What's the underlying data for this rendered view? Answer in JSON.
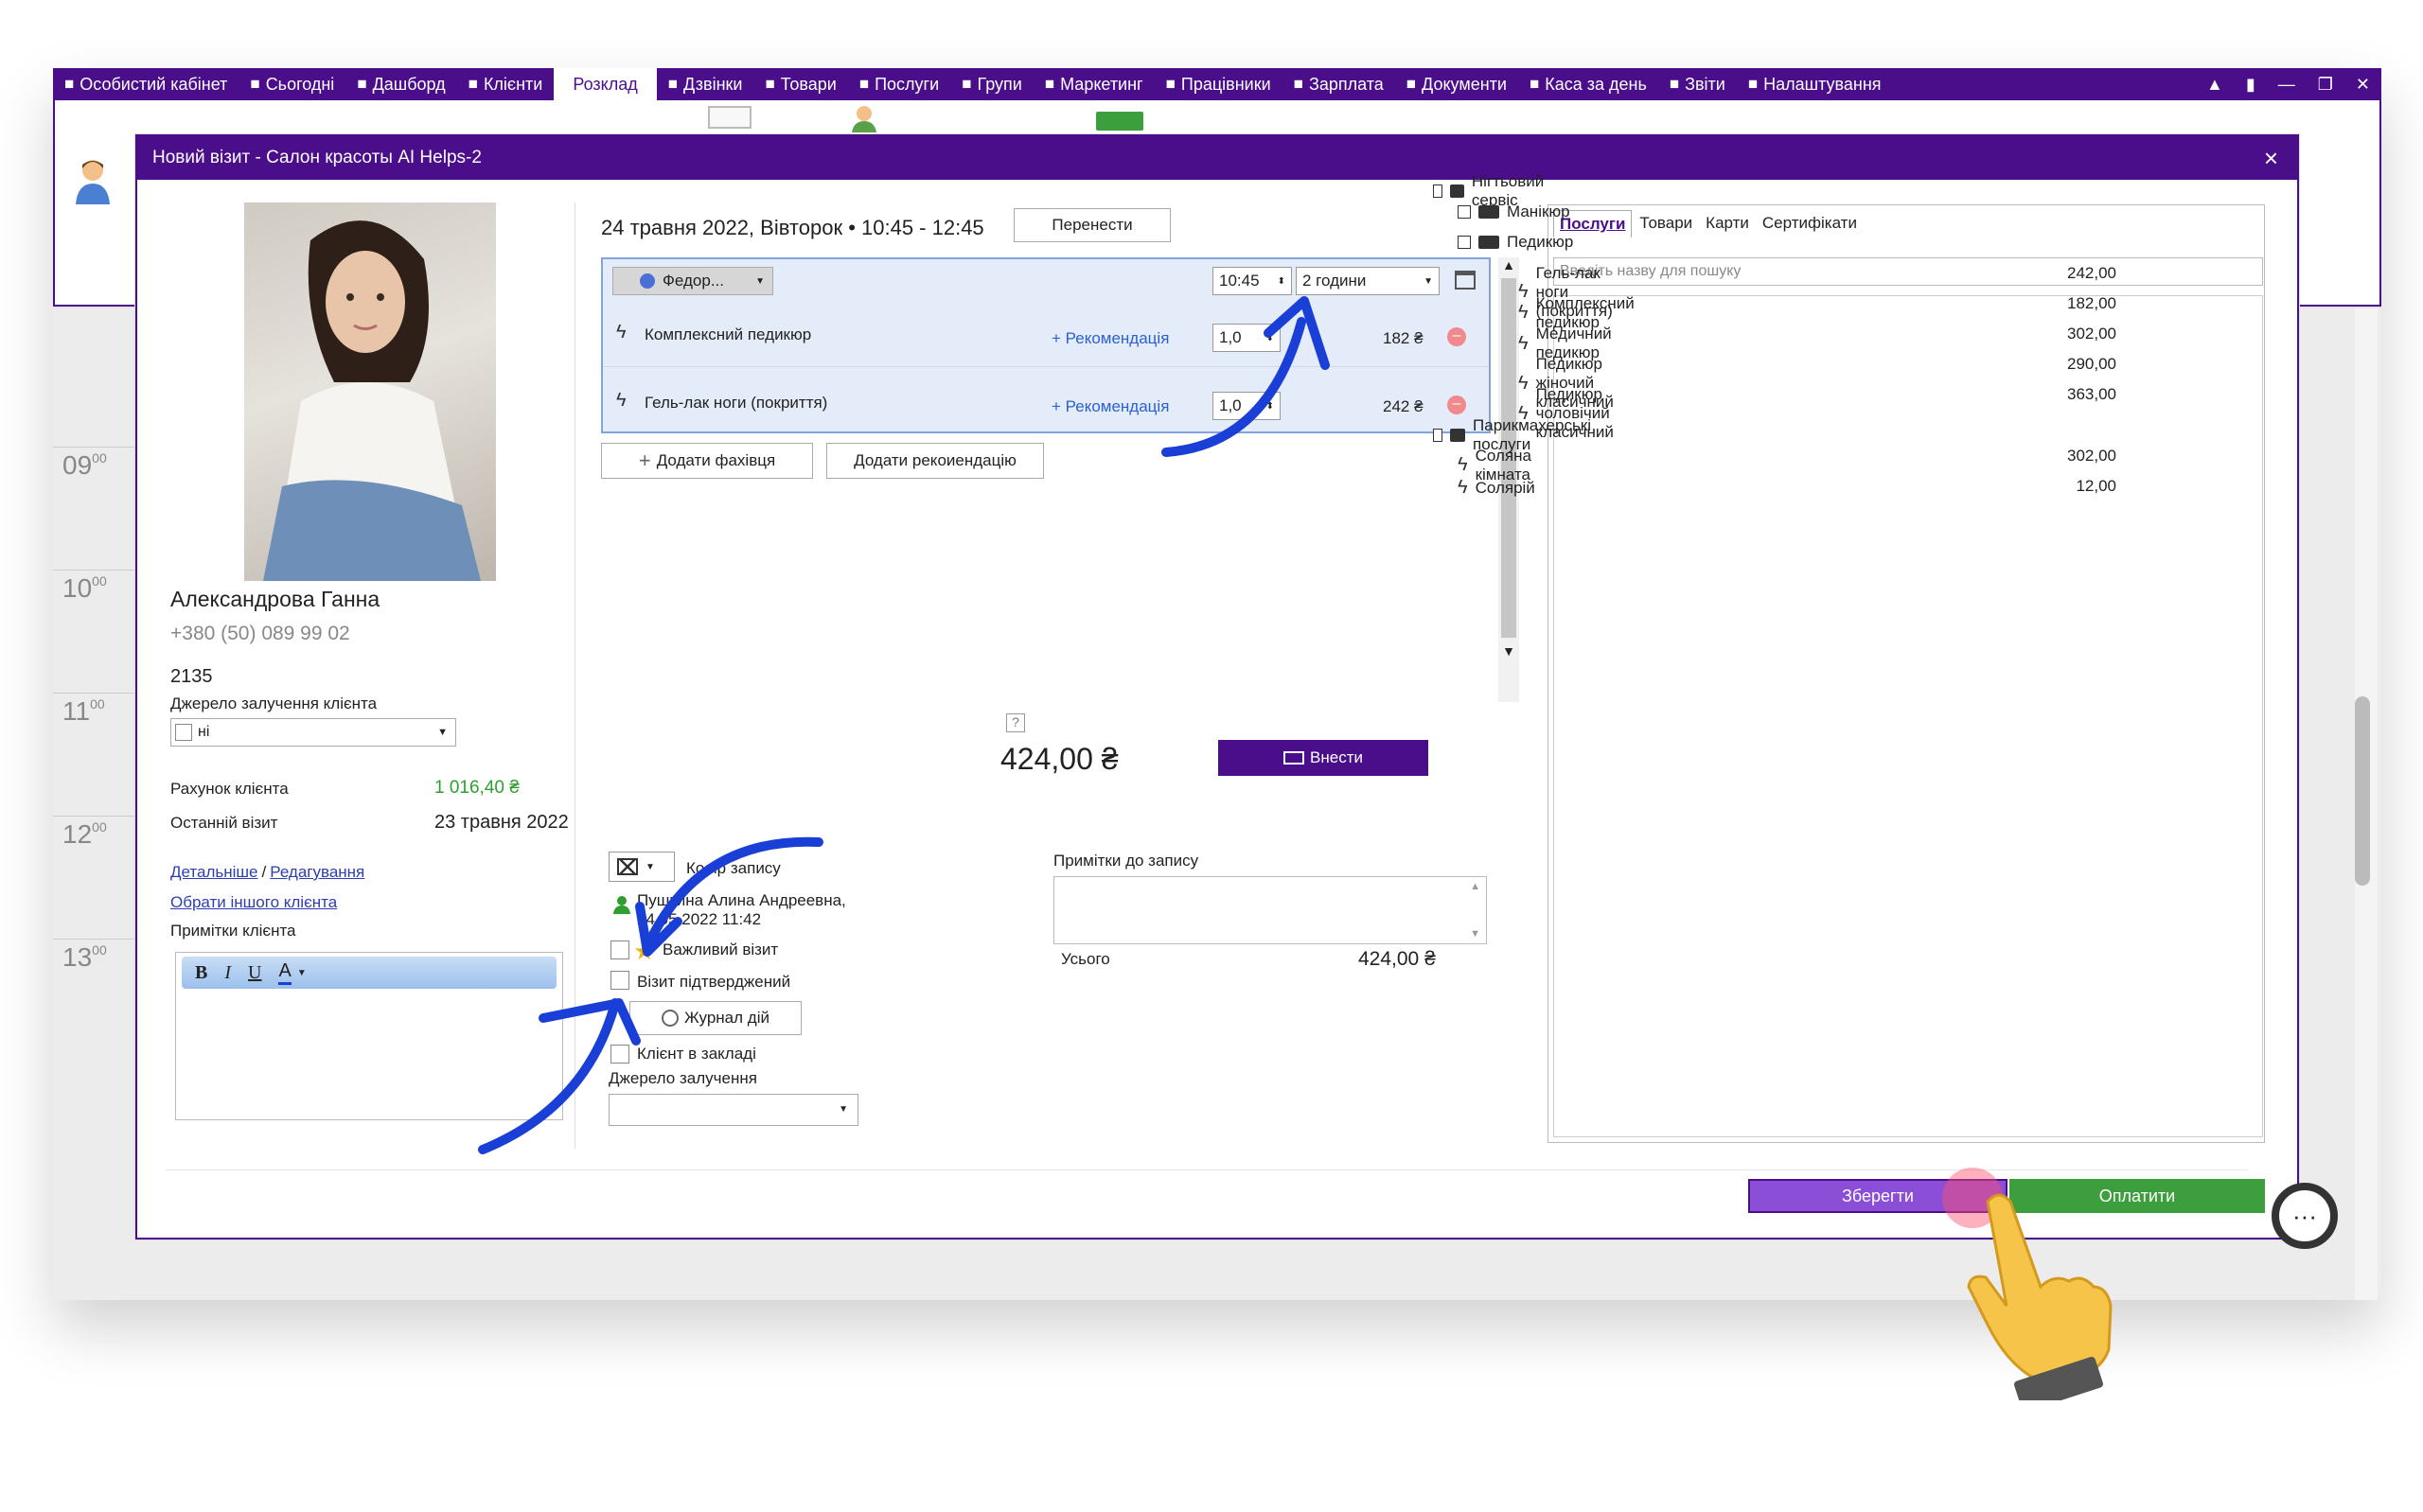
{
  "nav": {
    "items": [
      {
        "label": "Особистий кабінет",
        "icon": "briefcase-icon"
      },
      {
        "label": "Сьогодні",
        "icon": "moon-icon"
      },
      {
        "label": "Дашборд",
        "icon": "pulse-icon"
      },
      {
        "label": "Клієнти",
        "icon": "user-circle-icon"
      },
      {
        "label": "Розклад",
        "icon": ""
      },
      {
        "label": "Дзвінки",
        "icon": "phone-icon"
      },
      {
        "label": "Товари",
        "icon": "box-icon"
      },
      {
        "label": "Послуги",
        "icon": "bolt-icon"
      },
      {
        "label": "Групи",
        "icon": "group-icon"
      },
      {
        "label": "Маркетинг",
        "icon": "megaphone-icon"
      },
      {
        "label": "Працівники",
        "icon": "person-icon"
      },
      {
        "label": "Зарплата",
        "icon": "money-icon"
      },
      {
        "label": "Документи",
        "icon": "document-icon"
      },
      {
        "label": "Каса за день",
        "icon": "calculator-icon"
      },
      {
        "label": "Звіти",
        "icon": "bar-chart-icon"
      },
      {
        "label": "Налаштування",
        "icon": "gear-icon"
      }
    ],
    "active": "Розклад"
  },
  "calendar": {
    "hours": [
      "09",
      "10",
      "11",
      "12",
      "13"
    ],
    "minutes": "00"
  },
  "dialog": {
    "title": "Новий візит - Салон красоты AI Helps-2",
    "close": "×",
    "client": {
      "name": "Александрова Ганна",
      "phone": "+380 (50) 089 99 02",
      "id": "2135",
      "source_label": "Джерело залучення клієнта",
      "source_value": "ні",
      "account_label": "Рахунок клієнта",
      "account_value": "1 016,40 ₴",
      "last_visit_label": "Останній візит",
      "last_visit_value": "23 травня 2022",
      "details_link": "Детальніше",
      "separator": "/",
      "edit_link": "Редагування",
      "other_client_link": "Обрати іншого клієнта",
      "notes_label": "Примітки клієнта",
      "editor": {
        "bold": "B",
        "italic": "I",
        "underline": "U",
        "color": "A"
      }
    },
    "visit": {
      "datetime": "24 травня 2022, Вівторок • 10:45 - 12:45",
      "reschedule": "Перенести",
      "specialist": "Федор...",
      "start_time": "10:45",
      "duration": "2 години",
      "services": [
        {
          "name": "Комплексний педикюр",
          "rec": "+ Рекомендація",
          "qty": "1,0",
          "price": "182 ₴"
        },
        {
          "name": "Гель-лак ноги (покриття)",
          "rec": "+ Рекомендація",
          "qty": "1,0",
          "price": "242 ₴"
        }
      ],
      "add_specialist": "Додати фахівця",
      "add_recommendation": "Додати рекоиендацію",
      "help": "?",
      "total": "424,00 ₴",
      "deposit_button": "Внести",
      "color_label": "Колір запису",
      "created_by": "Пушкина Алина Андреевна,",
      "created_at": "24.05.2022 11:42",
      "important_label": "Важливий візит",
      "confirmed_label": "Візит підтверджений",
      "journal_button": "Журнал дій",
      "client_in_salon_label": "Клієнт в закладі",
      "source_label": "Джерело залучення",
      "notes_label": "Примітки до запису",
      "sum_label": "Усього",
      "sum_value": "424,00 ₴"
    },
    "catalog": {
      "tabs": [
        "Послуги",
        "Товари",
        "Карти",
        "Сертифікати"
      ],
      "active_tab": "Послуги",
      "search_placeholder": "Введіть назву для пошуку",
      "tree": [
        {
          "level": 0,
          "type": "folder",
          "label": "Нігтьовий сервіс",
          "price": ""
        },
        {
          "level": 1,
          "type": "folder",
          "label": "Манікюр",
          "price": ""
        },
        {
          "level": 1,
          "type": "folder",
          "label": "Педикюр",
          "price": ""
        },
        {
          "level": 2,
          "type": "service",
          "label": "Гель-лак ноги (покриття)",
          "price": "242,00"
        },
        {
          "level": 2,
          "type": "service",
          "label": "Комплексний педикюр",
          "price": "182,00"
        },
        {
          "level": 2,
          "type": "service",
          "label": "Медичний педикюр",
          "price": "302,00"
        },
        {
          "level": 2,
          "type": "service",
          "label": "Педикюр жіночий класичний",
          "price": "290,00"
        },
        {
          "level": 2,
          "type": "service",
          "label": "Педикюр чоловічий класичний",
          "price": "363,00"
        },
        {
          "level": 0,
          "type": "folder",
          "label": "Парикмахерські послуги",
          "price": ""
        },
        {
          "level": 1,
          "type": "service",
          "label": "Соляна кімната",
          "price": "302,00"
        },
        {
          "level": 1,
          "type": "service",
          "label": "Солярій",
          "price": "12,00"
        }
      ]
    },
    "save_button": "Зберегти",
    "pay_button": "Оплатити"
  },
  "colors": {
    "brand": "#4a0e8a",
    "save": "#8a4fd6",
    "pay": "#3c9e3c",
    "arrow": "#1a3fd6",
    "account": "#2e9e2e"
  }
}
